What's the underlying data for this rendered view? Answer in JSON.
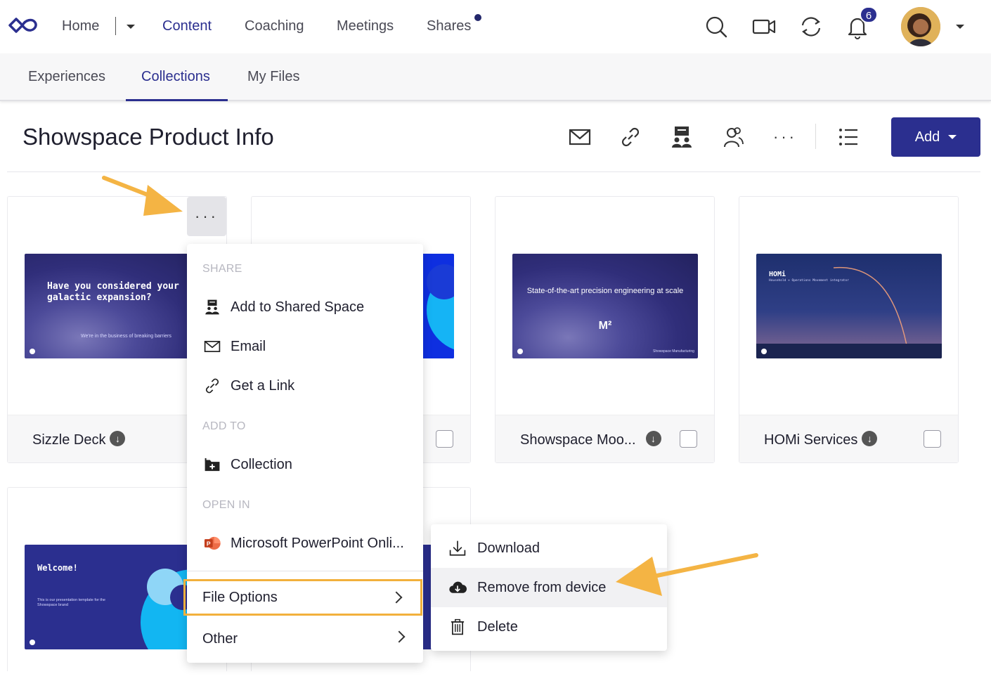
{
  "nav": {
    "items": [
      {
        "label": "Home"
      },
      {
        "label": "Content"
      },
      {
        "label": "Coaching"
      },
      {
        "label": "Meetings"
      },
      {
        "label": "Shares"
      }
    ],
    "notifications_count": "6"
  },
  "subnav": {
    "tabs": [
      {
        "label": "Experiences"
      },
      {
        "label": "Collections"
      },
      {
        "label": "My Files"
      }
    ]
  },
  "header": {
    "title": "Showspace Product Info",
    "add_label": "Add",
    "more_label": "···"
  },
  "cards": [
    {
      "name": "Sizzle Deck",
      "thumb_title": "Have you considered your galactic expansion?",
      "thumb_caption": "We're in the business of breaking barriers"
    },
    {
      "name": ""
    },
    {
      "name": "Showspace Moo...",
      "thumb_title": "State-of-the-art precision engineering at scale",
      "thumb_mark": "M²",
      "thumb_footer": "Showspace Manufacturing"
    },
    {
      "name": "HOMi Services",
      "thumb_title": "HOMi",
      "thumb_caption": "Household + Operations Movement integrator"
    },
    {
      "thumb_title": "Welcome!",
      "thumb_caption": "This is our presentation template for the Showspace brand"
    }
  ],
  "context_menu": {
    "more_button": "···",
    "share_heading": "SHARE",
    "add_to_shared_space": "Add to Shared Space",
    "email": "Email",
    "get_link": "Get a Link",
    "add_to_heading": "ADD TO",
    "collection": "Collection",
    "open_in_heading": "OPEN IN",
    "powerpoint": "Microsoft PowerPoint Onli...",
    "file_options": "File Options",
    "other": "Other"
  },
  "submenu": {
    "download": "Download",
    "remove_from_device": "Remove from device",
    "delete": "Delete"
  },
  "colors": {
    "accent": "#2b2f8f",
    "highlight": "#f2b03c",
    "arrow": "#f4b444"
  }
}
